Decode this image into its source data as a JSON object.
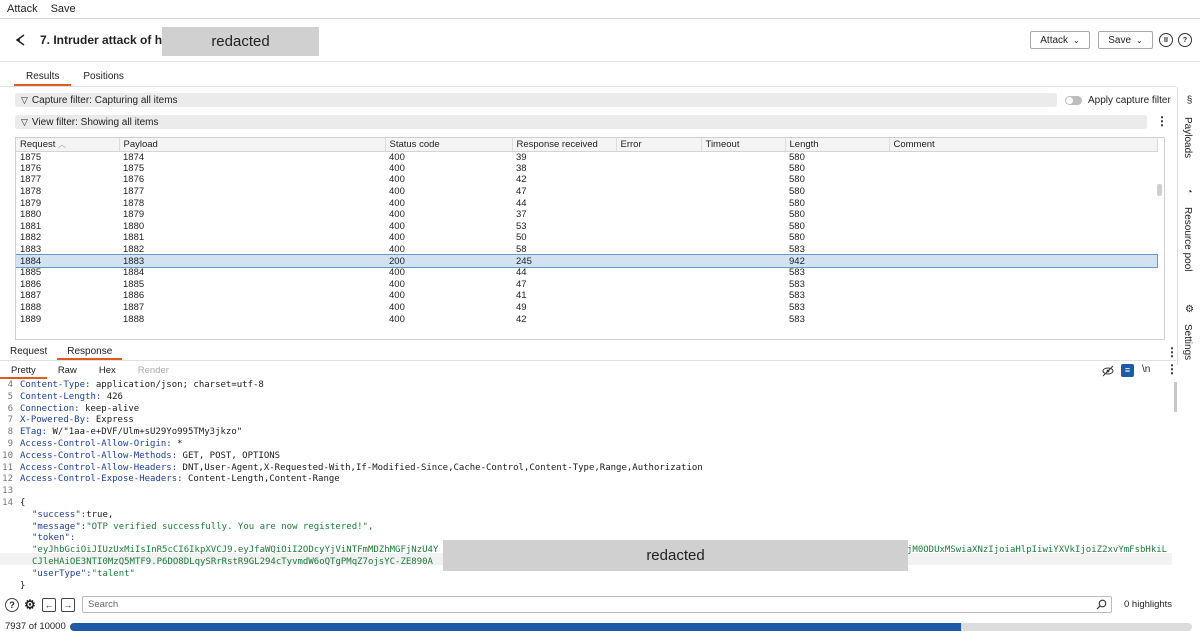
{
  "menu": {
    "items": [
      "Attack",
      "Save"
    ]
  },
  "header": {
    "title": "7. Intruder attack of https",
    "redaction_label": "redacted",
    "attack_button": "Attack",
    "save_button": "Save"
  },
  "subtabs": [
    "Results",
    "Positions"
  ],
  "capture_filter": "Capture filter: Capturing all items",
  "view_filter": "View filter: Showing all items",
  "apply_capture_filter": "Apply capture filter",
  "table": {
    "columns": [
      "Request",
      "Payload",
      "Status code",
      "Response received",
      "Error",
      "Timeout",
      "Length",
      "Comment"
    ],
    "rows": [
      [
        "1875",
        "1874",
        "400",
        "39",
        "",
        "",
        "580",
        ""
      ],
      [
        "1876",
        "1875",
        "400",
        "38",
        "",
        "",
        "580",
        ""
      ],
      [
        "1877",
        "1876",
        "400",
        "42",
        "",
        "",
        "580",
        ""
      ],
      [
        "1878",
        "1877",
        "400",
        "47",
        "",
        "",
        "580",
        ""
      ],
      [
        "1879",
        "1878",
        "400",
        "44",
        "",
        "",
        "580",
        ""
      ],
      [
        "1880",
        "1879",
        "400",
        "37",
        "",
        "",
        "580",
        ""
      ],
      [
        "1881",
        "1880",
        "400",
        "53",
        "",
        "",
        "580",
        ""
      ],
      [
        "1882",
        "1881",
        "400",
        "50",
        "",
        "",
        "580",
        ""
      ],
      [
        "1883",
        "1882",
        "400",
        "58",
        "",
        "",
        "583",
        ""
      ],
      [
        "1884",
        "1883",
        "200",
        "245",
        "",
        "",
        "942",
        ""
      ],
      [
        "1885",
        "1884",
        "400",
        "44",
        "",
        "",
        "583",
        ""
      ],
      [
        "1886",
        "1885",
        "400",
        "47",
        "",
        "",
        "583",
        ""
      ],
      [
        "1887",
        "1886",
        "400",
        "41",
        "",
        "",
        "583",
        ""
      ],
      [
        "1888",
        "1887",
        "400",
        "49",
        "",
        "",
        "583",
        ""
      ],
      [
        "1889",
        "1888",
        "400",
        "42",
        "",
        "",
        "583",
        ""
      ]
    ],
    "selected_row": 9
  },
  "reqres_tabs": [
    "Request",
    "Response"
  ],
  "view_tabs": [
    "Pretty",
    "Raw",
    "Hex",
    "Render"
  ],
  "ln_label": "\\n",
  "response_lines": [
    {
      "n": "4",
      "key": "Content-Type:",
      "val": " application/json; charset=utf-8"
    },
    {
      "n": "5",
      "key": "Content-Length:",
      "val": " 426"
    },
    {
      "n": "6",
      "key": "Connection:",
      "val": " keep-alive"
    },
    {
      "n": "7",
      "key": "X-Powered-By:",
      "val": " Express"
    },
    {
      "n": "8",
      "key": "ETag:",
      "val": " W/\"1aa-e+DVF/Ulm+sU29Yo995TMy3jkzo\""
    },
    {
      "n": "9",
      "key": "Access-Control-Allow-Origin:",
      "val": " *"
    },
    {
      "n": "10",
      "key": "Access-Control-Allow-Methods:",
      "val": " GET, POST, OPTIONS"
    },
    {
      "n": "11",
      "key": "Access-Control-Allow-Headers:",
      "val": " DNT,User-Agent,X-Requested-With,If-Modified-Since,Cache-Control,Content-Type,Range,Authorization"
    },
    {
      "n": "12",
      "key": "Access-Control-Expose-Headers:",
      "val": " Content-Length,Content-Range"
    },
    {
      "n": "13",
      "key": "",
      "val": ""
    },
    {
      "n": "14",
      "key": "",
      "val": "{"
    }
  ],
  "json_body": {
    "success_key": "\"success\":",
    "success_val": "true,",
    "message_key": "\"message\":",
    "message_val": "\"OTP verified successfully. You are now registered!\",",
    "token_key": "\"token\":",
    "token_line1_a": "\"eyJhbGciOiJIUzUxMiIsInR5cCI6IkpXVCJ9.eyJfaWQiOiI2ODcyYjViNTFmMDZhMGFjNzU4Y",
    "token_line1_b": "jM0ODUxMSwiaXNzIjoiaHlpIiwiYXVkIjoiZ2xvYmFsbHkiL",
    "token_line2": "CJleHAiO",
    "token_line2_rest": "E3NTI0MzQ5MTF9.P6DO8DLqySRrRstR9GL294cTyvmdW6oQTgPMqZ7ojsYC-ZE890A",
    "usertype_key": "\"userType\":",
    "usertype_val": "\"talent\"",
    "close": "}"
  },
  "search_placeholder": "Search",
  "highlights": "0 highlights",
  "status": "7937 of 10000",
  "progress_fraction": 0.7937,
  "side_panel": [
    "Payloads",
    "Resource pool",
    "Settings"
  ]
}
